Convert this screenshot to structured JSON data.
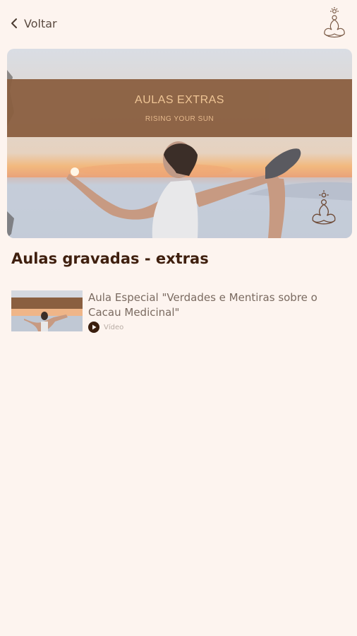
{
  "header": {
    "back_label": "Voltar",
    "back_icon": "chevron-left-icon",
    "logo_icon": "lotus-meditation-logo"
  },
  "banner": {
    "title": "AULAS EXTRAS",
    "subtitle": "RISING YOUR SUN"
  },
  "section": {
    "title": "Aulas gravadas - extras"
  },
  "items": [
    {
      "title": "Aula Especial \"Verdades e Mentiras sobre o Cacau Medicinal\"",
      "type": "Vídeo",
      "icon": "play-circle-icon"
    }
  ],
  "colors": {
    "background": "#fdf4ef",
    "accent": "#8a5f40",
    "title": "#3f1f0e"
  }
}
